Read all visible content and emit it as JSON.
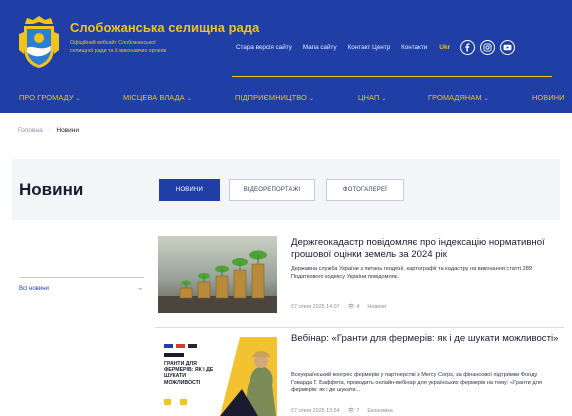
{
  "header": {
    "title": "Слобожанська селищна рада",
    "subtitle": "Офіційний вебсайт Слобожанської селищної ради та її виконавчих органів",
    "top_links": [
      "Стара версія сайту",
      "Мапа сайту",
      "Контакт Центр",
      "Контакти"
    ],
    "language": "Ukr",
    "social": [
      "facebook-icon",
      "instagram-icon",
      "youtube-icon"
    ],
    "colors": {
      "primary": "#1f3fa6",
      "accent": "#f0c419"
    }
  },
  "nav": {
    "items": [
      {
        "label": "ПРО ГРОМАДУ",
        "dropdown": true
      },
      {
        "label": "МІСЦЕВА ВЛАДА",
        "dropdown": true
      },
      {
        "label": "ПІДПРИЄМНИЦТВО",
        "dropdown": true
      },
      {
        "label": "ЦНАП",
        "dropdown": true
      },
      {
        "label": "ГРОМАДЯНАМ",
        "dropdown": true
      },
      {
        "label": "НОВИНИ",
        "dropdown": false
      }
    ]
  },
  "breadcrumb": {
    "home": "Головна",
    "current": "Новини"
  },
  "page": {
    "title": "Новини"
  },
  "tabs": [
    {
      "label": "НОВИНИ",
      "active": true
    },
    {
      "label": "ВІДЕОРЕПОРТАЖІ",
      "active": false
    },
    {
      "label": "ФОТОГАЛЕРЕЇ",
      "active": false
    }
  ],
  "sidebar": {
    "all_news": "Всі новини"
  },
  "news": [
    {
      "title": "Держгеокадастр повідомляє про індексацію нормативної грошової оцінки земель за 2024 рік",
      "excerpt": "Державна служба України з питань геодезії, картографії та кадастру на виконання статті 289 Податкового кодексу України повідомляє.",
      "date": "27 січня 2025 14:07",
      "views": "4",
      "category": "Новини"
    },
    {
      "title": "Вебінар: «Гранти для фермерів: як і де шукати можливості»",
      "excerpt": "Всеукраїнський конгрес фермерів у партнерстві з Mercy Corps, за фінансової підтримки Фонду Говарда Г. Баффета, проводить онлайн-вебінар для українських фермерів на тему: «Гранти для фермерів: як і де шукати...",
      "date": "27 січня 2025 13:54",
      "views": "7",
      "category": "Економіка",
      "image_text": "ГРАНТИ ДЛЯ ФЕРМЕРІВ: ЯК І ДЕ ШУКАТИ МОЖЛИВОСТІ"
    }
  ]
}
